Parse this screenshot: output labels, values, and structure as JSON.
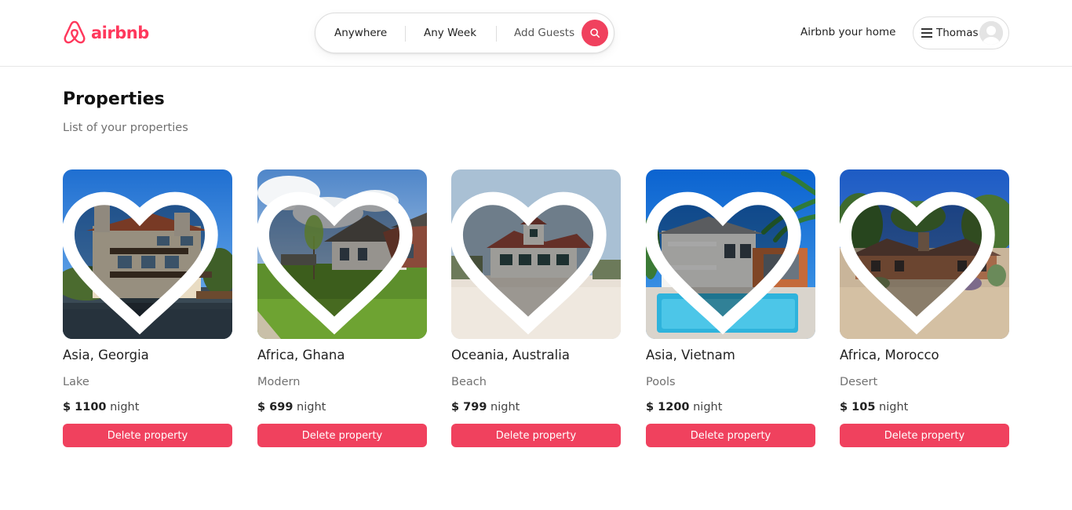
{
  "header": {
    "logo_text": "airbnb",
    "brand_color": "#ff385c",
    "search": {
      "location": "Anywhere",
      "dates": "Any Week",
      "guests": "Add Guests",
      "button_icon": "search-icon"
    },
    "host_link": "Airbnb your home",
    "user_menu": {
      "menu_icon": "hamburger-icon",
      "name": "Thomas",
      "avatar_icon": "avatar-icon"
    }
  },
  "page": {
    "title": "Properties",
    "subtitle": "List of your properties"
  },
  "properties": [
    {
      "location": "Asia, Georgia",
      "category": "Lake",
      "price": "$ 1100",
      "unit": "night",
      "delete_label": "Delete property"
    },
    {
      "location": "Africa, Ghana",
      "category": "Modern",
      "price": "$ 699",
      "unit": "night",
      "delete_label": "Delete property"
    },
    {
      "location": "Oceania, Australia",
      "category": "Beach",
      "price": "$ 799",
      "unit": "night",
      "delete_label": "Delete property"
    },
    {
      "location": "Asia, Vietnam",
      "category": "Pools",
      "price": "$ 1200",
      "unit": "night",
      "delete_label": "Delete property"
    },
    {
      "location": "Africa, Morocco",
      "category": "Desert",
      "price": "$ 105",
      "unit": "night",
      "delete_label": "Delete property"
    }
  ],
  "colors": {
    "accent": "#f0415e",
    "muted_text": "#717171"
  }
}
